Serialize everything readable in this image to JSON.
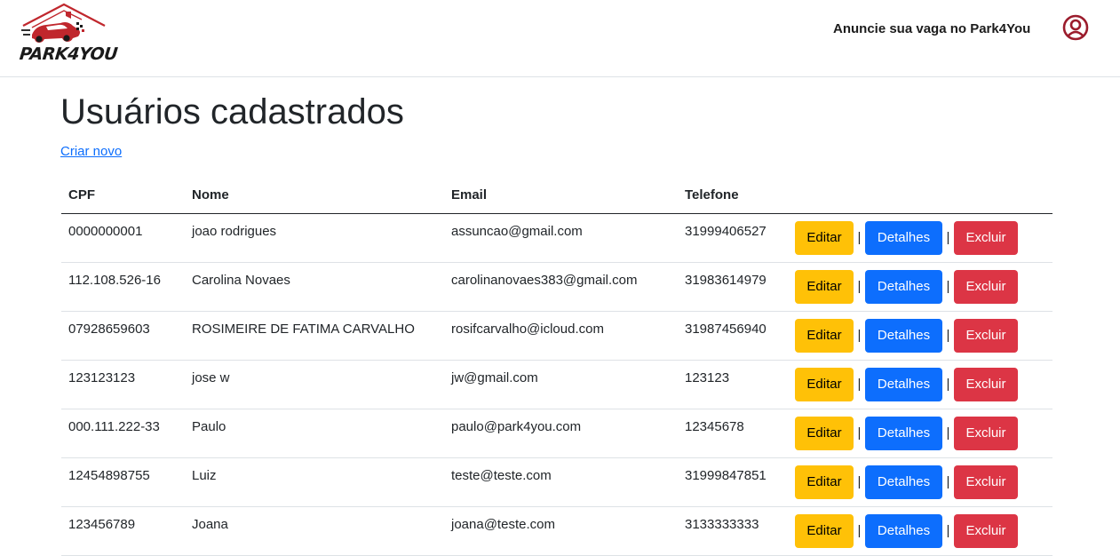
{
  "brand": {
    "name": "PARK4YOU"
  },
  "nav": {
    "advertise_link": "Anuncie sua vaga no Park4You"
  },
  "page": {
    "title": "Usuários cadastrados",
    "create_link": "Criar novo"
  },
  "table": {
    "headers": [
      "CPF",
      "Nome",
      "Email",
      "Telefone"
    ],
    "actions": {
      "edit": "Editar",
      "details": "Detalhes",
      "delete": "Excluir",
      "separator": "|"
    },
    "rows": [
      {
        "cpf": "0000000001",
        "nome": "joao rodrigues",
        "email": "assuncao@gmail.com",
        "telefone": "31999406527"
      },
      {
        "cpf": "112.108.526-16",
        "nome": "Carolina Novaes",
        "email": "carolinanovaes383@gmail.com",
        "telefone": "31983614979"
      },
      {
        "cpf": "07928659603",
        "nome": "ROSIMEIRE DE FATIMA CARVALHO",
        "email": "rosifcarvalho@icloud.com",
        "telefone": "31987456940"
      },
      {
        "cpf": "123123123",
        "nome": "jose w",
        "email": "jw@gmail.com",
        "telefone": "123123"
      },
      {
        "cpf": "000.111.222-33",
        "nome": "Paulo",
        "email": "paulo@park4you.com",
        "telefone": "12345678"
      },
      {
        "cpf": "12454898755",
        "nome": "Luiz",
        "email": "teste@teste.com",
        "telefone": "31999847851"
      },
      {
        "cpf": "123456789",
        "nome": "Joana",
        "email": "joana@teste.com",
        "telefone": "3133333333"
      }
    ]
  },
  "colors": {
    "edit": "#ffc107",
    "details": "#0d6efd",
    "delete": "#dc3545",
    "link": "#0d6efd",
    "brand_red": "#c0272d",
    "user_icon": "#9b1c2c"
  },
  "icons": {
    "logo": "house-car-logo-icon",
    "user": "user-circle-icon"
  }
}
